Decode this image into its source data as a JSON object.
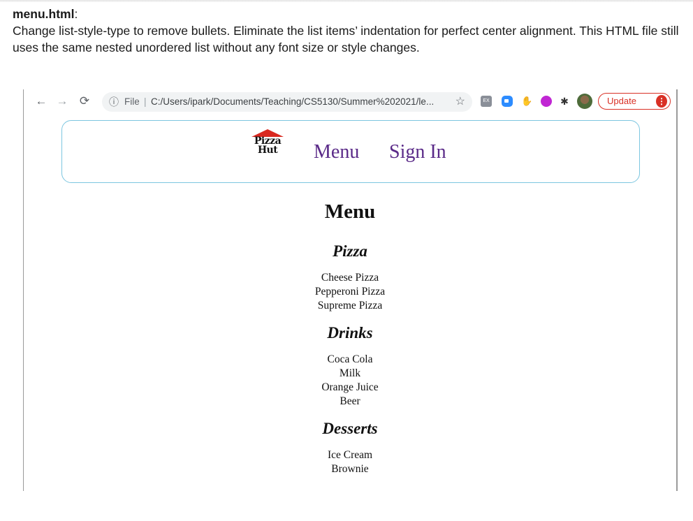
{
  "instructions": {
    "filename": "menu.html",
    "text": "Change list-style-type to remove bullets. Eliminate the list items’ indentation for perfect center alignment. This HTML file still uses the same nested unordered list without any font size or style changes."
  },
  "browser": {
    "omnibox": {
      "file_label": "File",
      "url": "C:/Users/ipark/Documents/Teaching/CS5130/Summer%202021/le..."
    },
    "update_label": "Update",
    "extensions": [
      "ex-icon",
      "zoom-icon",
      "hand-icon",
      "purple-extension-icon",
      "puzzle-icon"
    ]
  },
  "site_header": {
    "logo_text_line1": "Pizza",
    "logo_text_line2": "Hut",
    "nav": [
      "Menu",
      "Sign In"
    ]
  },
  "menu": {
    "title": "Menu",
    "categories": [
      {
        "name": "Pizza",
        "items": [
          "Cheese Pizza",
          "Pepperoni Pizza",
          "Supreme Pizza"
        ]
      },
      {
        "name": "Drinks",
        "items": [
          "Coca Cola",
          "Milk",
          "Orange Juice",
          "Beer"
        ]
      },
      {
        "name": "Desserts",
        "items": [
          "Ice Cream",
          "Brownie"
        ]
      }
    ]
  },
  "colors": {
    "nav_link": "#5a2a88",
    "header_border": "#7cc6e0",
    "update_red": "#d93025",
    "logo_red": "#d9281f"
  }
}
